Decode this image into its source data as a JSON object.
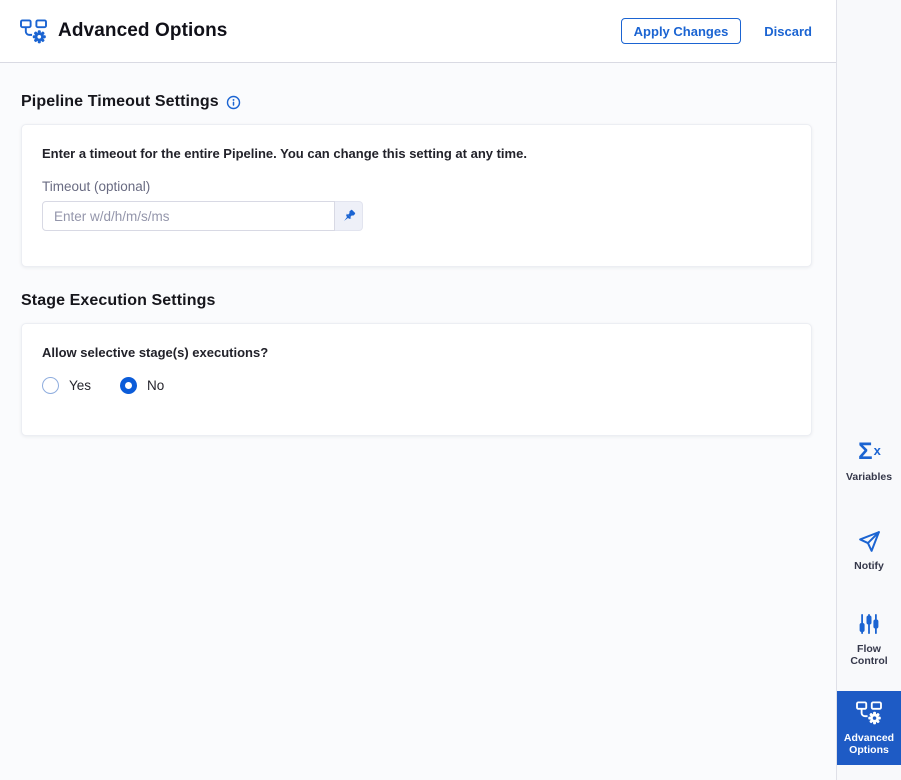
{
  "header": {
    "icon": "pipeline-gear-icon",
    "title": "Advanced Options",
    "apply_label": "Apply Changes",
    "discard_label": "Discard"
  },
  "sections": {
    "pipeline_timeout": {
      "heading": "Pipeline Timeout Settings",
      "info_icon": "info-icon",
      "description": "Enter a timeout for the entire Pipeline. You can change this setting at any time.",
      "timeout_label": "Timeout (optional)",
      "timeout_placeholder": "Enter w/d/h/m/s/ms",
      "timeout_value": "",
      "pin_icon": "pushpin-icon"
    },
    "stage_execution": {
      "heading": "Stage Execution Settings",
      "question": "Allow selective stage(s) executions?",
      "options": [
        {
          "label": "Yes",
          "selected": false
        },
        {
          "label": "No",
          "selected": true
        }
      ]
    }
  },
  "sidebar": {
    "items": [
      {
        "label": "Variables",
        "icon": "sigma-x-icon",
        "active": false
      },
      {
        "label": "Notify",
        "icon": "paper-plane-icon",
        "active": false
      },
      {
        "label": "Flow Control",
        "icon": "sliders-icon",
        "active": false
      },
      {
        "label": "Advanced Options",
        "icon": "pipeline-gear-icon",
        "active": true
      }
    ]
  },
  "colors": {
    "primary": "#1b64d2",
    "active_sidebar_bg": "#1e5bc5",
    "radio_selected": "#0b5cd9",
    "content_bg": "#fafbfd",
    "sidebar_bg": "#f8f9fb"
  }
}
